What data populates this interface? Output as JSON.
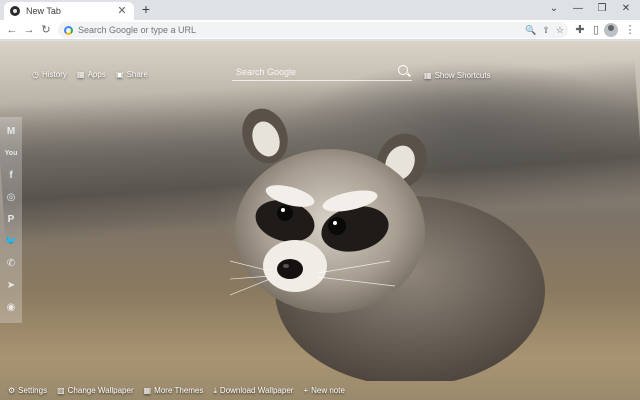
{
  "browser": {
    "tab_title": "New Tab",
    "tab_close": "✕",
    "new_tab": "+",
    "window_controls": {
      "dropdown": "⌄",
      "minimize": "—",
      "restore": "❐",
      "close": "✕"
    }
  },
  "toolbar": {
    "back": "←",
    "forward": "→",
    "reload": "↻",
    "omnibox_placeholder": "Search Google or type a URL",
    "zoom_icon": "🔍",
    "share_icon": "⇪",
    "bookmark_icon": "☆",
    "extensions_icon": "✚",
    "sidepanel_icon": "▯",
    "menu_icon": "⋮"
  },
  "newtab": {
    "nav": [
      {
        "icon": "history-icon",
        "glyph": "◷",
        "label": "History"
      },
      {
        "icon": "apps-icon",
        "glyph": "▦",
        "label": "Apps"
      },
      {
        "icon": "share-icon",
        "glyph": "▣",
        "label": "Share"
      }
    ],
    "search_placeholder": "Search Google",
    "shortcuts_glyph": "▦",
    "shortcuts_label": "Show Shortcuts"
  },
  "social": [
    {
      "name": "gmail-icon",
      "glyph": "M"
    },
    {
      "name": "youtube-icon",
      "glyph": "You"
    },
    {
      "name": "facebook-icon",
      "glyph": "f"
    },
    {
      "name": "instagram-icon",
      "glyph": "◎"
    },
    {
      "name": "pinterest-icon",
      "glyph": "P"
    },
    {
      "name": "twitter-icon",
      "glyph": "🐦"
    },
    {
      "name": "whatsapp-icon",
      "glyph": "✆"
    },
    {
      "name": "telegram-icon",
      "glyph": "➤"
    },
    {
      "name": "reddit-icon",
      "glyph": "◉"
    }
  ],
  "bottom_bar": [
    {
      "icon": "gear-icon",
      "glyph": "⚙",
      "label": "Settings"
    },
    {
      "icon": "wallpaper-icon",
      "glyph": "▨",
      "label": "Change Wallpaper"
    },
    {
      "icon": "themes-icon",
      "glyph": "▦",
      "label": "More Themes"
    },
    {
      "icon": "download-icon",
      "glyph": "⤓",
      "label": "Download Wallpaper"
    },
    {
      "icon": "plus-icon",
      "glyph": "+",
      "label": "New note"
    }
  ]
}
